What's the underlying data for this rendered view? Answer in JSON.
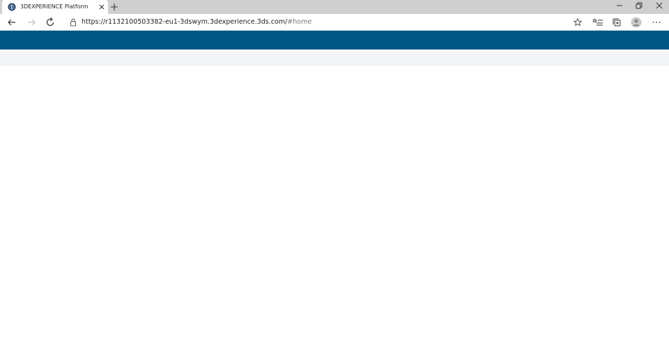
{
  "browser": {
    "tab": {
      "title": "3DEXPERIENCE Platform",
      "favicon": "3dexperience-compass-icon"
    },
    "address": {
      "url_main": "https://r1132100503382-eu1-3dswym.3dexperience.3ds.com/",
      "url_fragment": "#home"
    }
  },
  "colors": {
    "app_bar": "#005685",
    "sub_bar": "#f4f5f7",
    "tabstrip": "#cfcfcf"
  }
}
